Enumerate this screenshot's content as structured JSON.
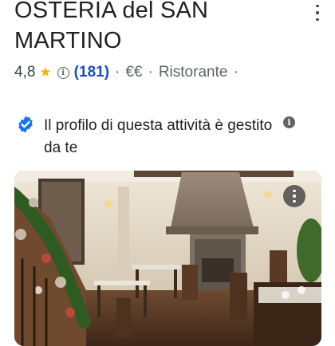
{
  "place": {
    "name": "OSTERIA del SAN MARTINO",
    "rating": "4,8",
    "reviews": "(181)",
    "price": "€€",
    "category": "Ristorante"
  },
  "separators": {
    "dot": "·"
  },
  "claim": {
    "text": "Il profilo di questa attività è gestito da te"
  },
  "icons": {
    "more": "more-vert-icon",
    "star": "star-icon",
    "info": "info-icon",
    "verified": "verified-badge-icon",
    "photo_more": "more-vert-icon"
  },
  "colors": {
    "star": "#f4b400",
    "reviews_link": "#1a4fb4",
    "verified": "#1a73e8",
    "text": "#202124",
    "muted": "#5f6368"
  }
}
